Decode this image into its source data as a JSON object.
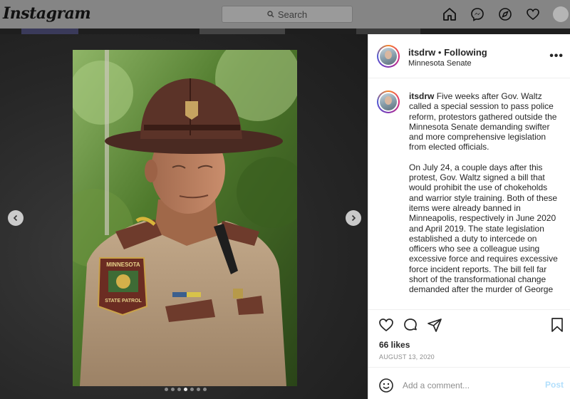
{
  "brand": {
    "logo_text": "Instagram"
  },
  "search": {
    "placeholder": "Search"
  },
  "nav": {
    "icons": [
      "home-icon",
      "messenger-icon",
      "explore-icon",
      "heart-icon",
      "profile-avatar"
    ]
  },
  "post": {
    "username": "itsdrw",
    "follow_status": "Following",
    "location": "Minnesota Senate",
    "caption_paragraphs": [
      "Five weeks after Gov. Waltz called a special session to pass police reform, protestors gathered outside the Minnesota Senate demanding swifter and more comprehensive legislation from elected officials.",
      "On July 24, a couple days after this protest, Gov. Waltz signed a bill that would prohibit the use of chokeholds and warrior style training. Both of these items were already banned in Minneapolis, respectively in June 2020 and April 2019. The state legislation established a duty to intercede on officers who see a colleague using excessive force and requires excessive force incident reports. The bill fell far short of the transformational change demanded after the murder of George"
    ],
    "likes": "66 likes",
    "date": "AUGUST 13, 2020",
    "comment_placeholder": "Add a comment...",
    "post_button": "Post",
    "carousel": {
      "count": 7,
      "active_index": 3
    },
    "photo_patch": {
      "top": "MINNESOTA",
      "bottom": "STATE PATROL"
    }
  },
  "colors": {
    "accent_blue": "#0095f6",
    "post_disabled": "#b2dffc"
  }
}
